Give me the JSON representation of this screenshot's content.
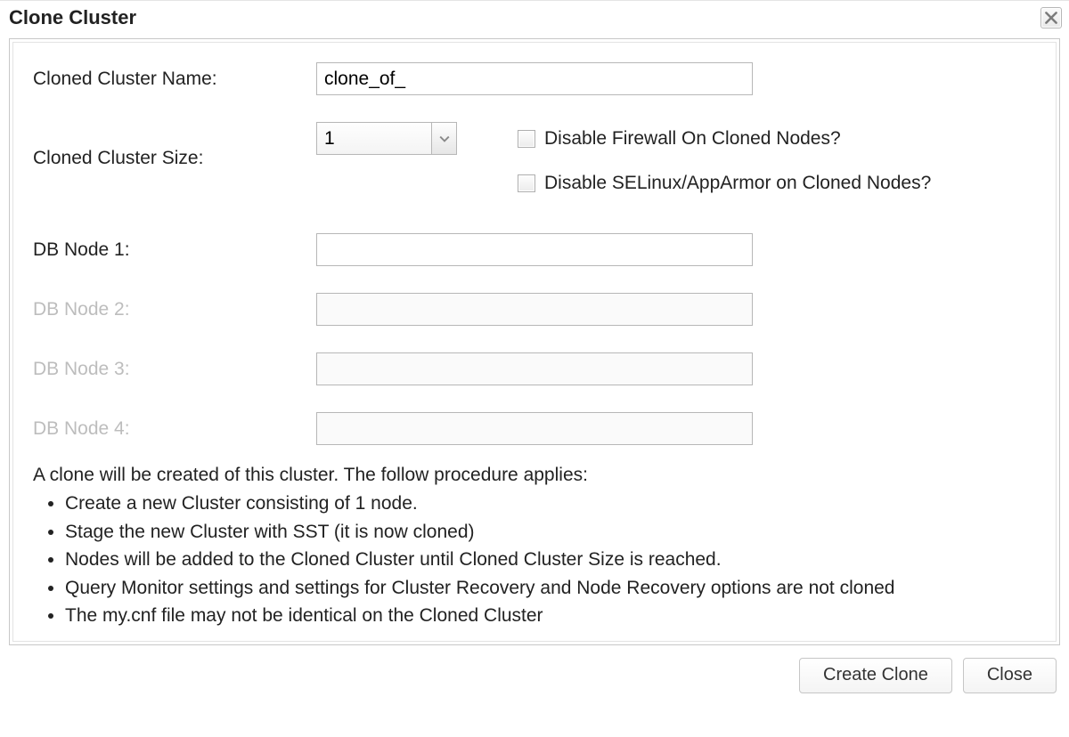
{
  "dialog": {
    "title": "Clone Cluster"
  },
  "form": {
    "cluster_name": {
      "label": "Cloned Cluster Name:",
      "value": "clone_of_"
    },
    "cluster_size": {
      "label": "Cloned Cluster Size:",
      "value": "1"
    },
    "disable_firewall": {
      "label": "Disable Firewall On Cloned Nodes?",
      "checked": false
    },
    "disable_selinux": {
      "label": "Disable SELinux/AppArmor on Cloned Nodes?",
      "checked": false
    },
    "nodes": [
      {
        "label": "DB Node 1:",
        "value": "",
        "enabled": true
      },
      {
        "label": "DB Node 2:",
        "value": "",
        "enabled": false
      },
      {
        "label": "DB Node 3:",
        "value": "",
        "enabled": false
      },
      {
        "label": "DB Node 4:",
        "value": "",
        "enabled": false
      }
    ]
  },
  "info": {
    "intro": "A clone will be created of this cluster. The follow procedure applies:",
    "bullets": [
      "Create a new Cluster consisting of 1 node.",
      "Stage the new Cluster with SST (it is now cloned)",
      "Nodes will be added to the Cloned Cluster until Cloned Cluster Size is reached.",
      "Query Monitor settings and settings for Cluster Recovery and Node Recovery options are not cloned",
      "The my.cnf file may not be identical on the Cloned Cluster"
    ]
  },
  "buttons": {
    "create": "Create Clone",
    "close": "Close"
  }
}
